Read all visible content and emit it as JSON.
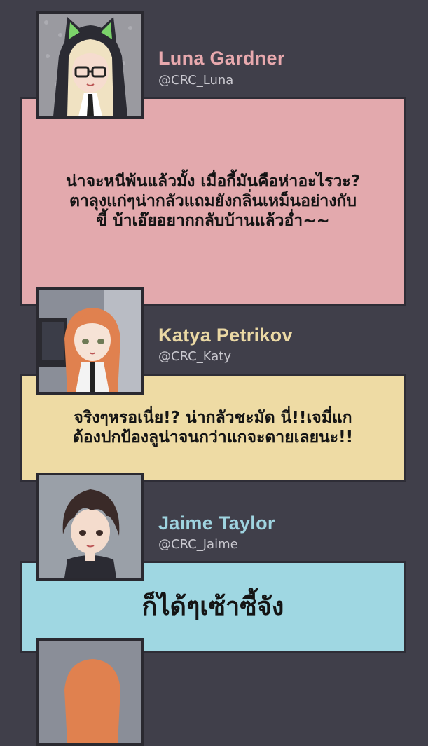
{
  "posts": [
    {
      "name": "Luna Gardner",
      "handle": "@CRC_Luna",
      "name_color": "#e8a9ae",
      "bubble_color": "#e3a9ad",
      "avatar_icon": "cat-hood-girl-avatar",
      "message": "น่าจะหนีพ้นแล้วมั้ง เมื่อกี้มันคือห่าอะไรวะ?\nตาลุงแก่ๆน่ากลัวแถมยังกลิ่นเหม็นอย่างกับ\nขี้ บ้าเอ๊ยอยากกลับบ้านแล้วอ่ำ~~"
    },
    {
      "name": "Katya Petrikov",
      "handle": "@CRC_Katy",
      "name_color": "#ead8a4",
      "bubble_color": "#eedba4",
      "avatar_icon": "orange-hair-girl-avatar",
      "message": "จริงๆหรอเนี่ย!? น่ากลัวชะมัด นี่!!เจมี่แก\nต้องปกป้องลูน่าจนกว่าแกจะตายเลยนะ!!"
    },
    {
      "name": "Jaime Taylor",
      "handle": "@CRC_Jaime",
      "name_color": "#9fd4e0",
      "bubble_color": "#9fd7e2",
      "avatar_icon": "dark-hair-boy-avatar",
      "message": "ก็ได้ๆเซ้าซี้จัง"
    }
  ]
}
